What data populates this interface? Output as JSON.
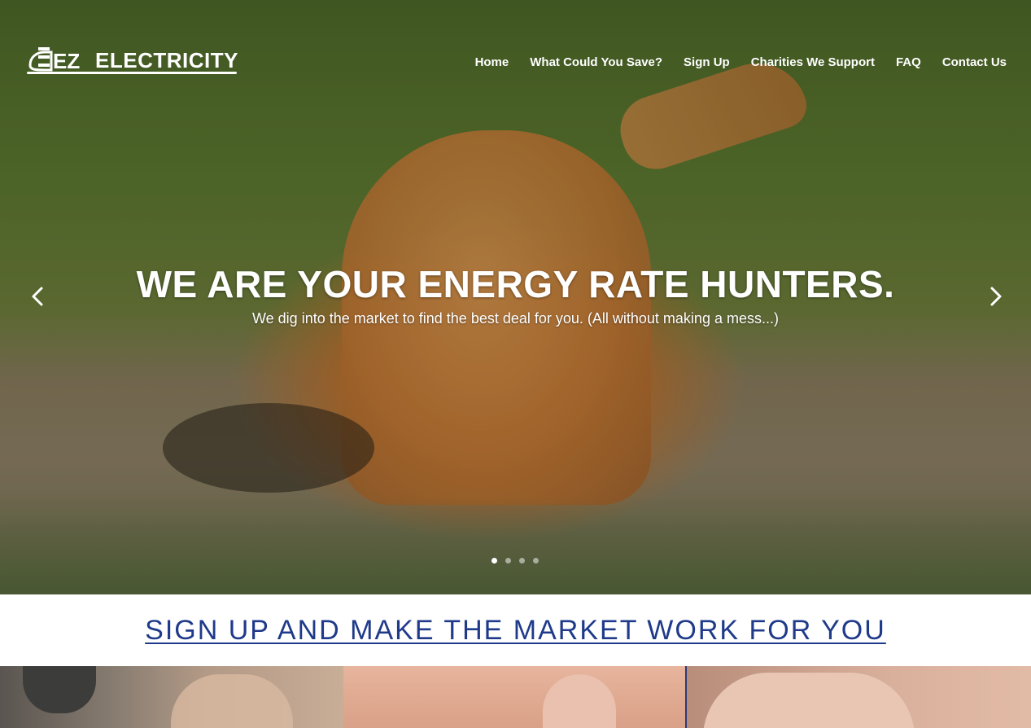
{
  "brand": {
    "logo_text": "ELECTRICITY",
    "logo_mark": "EZ"
  },
  "nav": {
    "items": [
      {
        "label": "Home"
      },
      {
        "label": "What Could You Save?"
      },
      {
        "label": "Sign Up"
      },
      {
        "label": "Charities We Support"
      },
      {
        "label": "FAQ"
      },
      {
        "label": "Contact Us"
      }
    ]
  },
  "hero": {
    "title": "WE ARE YOUR ENERGY RATE HUNTERS.",
    "subtitle": "We dig into the market to find the best deal for you. (All without making a mess...)",
    "slide_count": 4,
    "active_slide": 1,
    "prev_icon": "chevron-left-icon",
    "next_icon": "chevron-right-icon"
  },
  "cta": {
    "label": "SIGN UP AND MAKE THE MARKET WORK FOR YOU"
  },
  "colors": {
    "cta_link": "#1f3a8a",
    "nav_text": "#ffffff"
  }
}
